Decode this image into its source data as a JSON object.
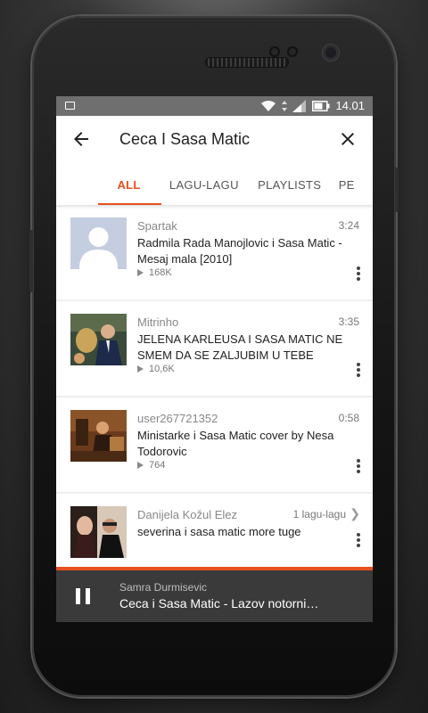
{
  "status_bar": {
    "time": "14.01"
  },
  "app_bar": {
    "title": "Ceca I Sasa Matic"
  },
  "tabs": [
    {
      "label": "ALL",
      "active": true
    },
    {
      "label": "LAGU-LAGU",
      "active": false
    },
    {
      "label": "PLAYLISTS",
      "active": false
    },
    {
      "label": "PE",
      "active": false
    }
  ],
  "results": [
    {
      "uploader": "Spartak",
      "duration": "3:24",
      "title": "Radmila Rada Manojlovic i Sasa Matic - Mesaj mala [2010]",
      "plays": "168K"
    },
    {
      "uploader": "Mitrinho",
      "duration": "3:35",
      "title": "JELENA KARLEUSA I SASA MATIC   NE SMEM DA SE ZALJUBIM U TEBE",
      "plays": "10,6K"
    },
    {
      "uploader": "user267721352",
      "duration": "0:58",
      "title": "Ministarke i Sasa Matic cover by Nesa Todorovic",
      "plays": "764"
    },
    {
      "uploader": "Danijela Kožul Elez",
      "duration": "1 lagu-lagu",
      "title": "severina i  sasa matic more tuge",
      "plays": ""
    }
  ],
  "player": {
    "artist": "Samra Durmisevic",
    "title": "Ceca i Sasa Matic - Lazov notorni…"
  },
  "colors": {
    "accent": "#e8501e",
    "status_bar": "#6f6f6f",
    "player_bg": "#3b3a3a"
  }
}
